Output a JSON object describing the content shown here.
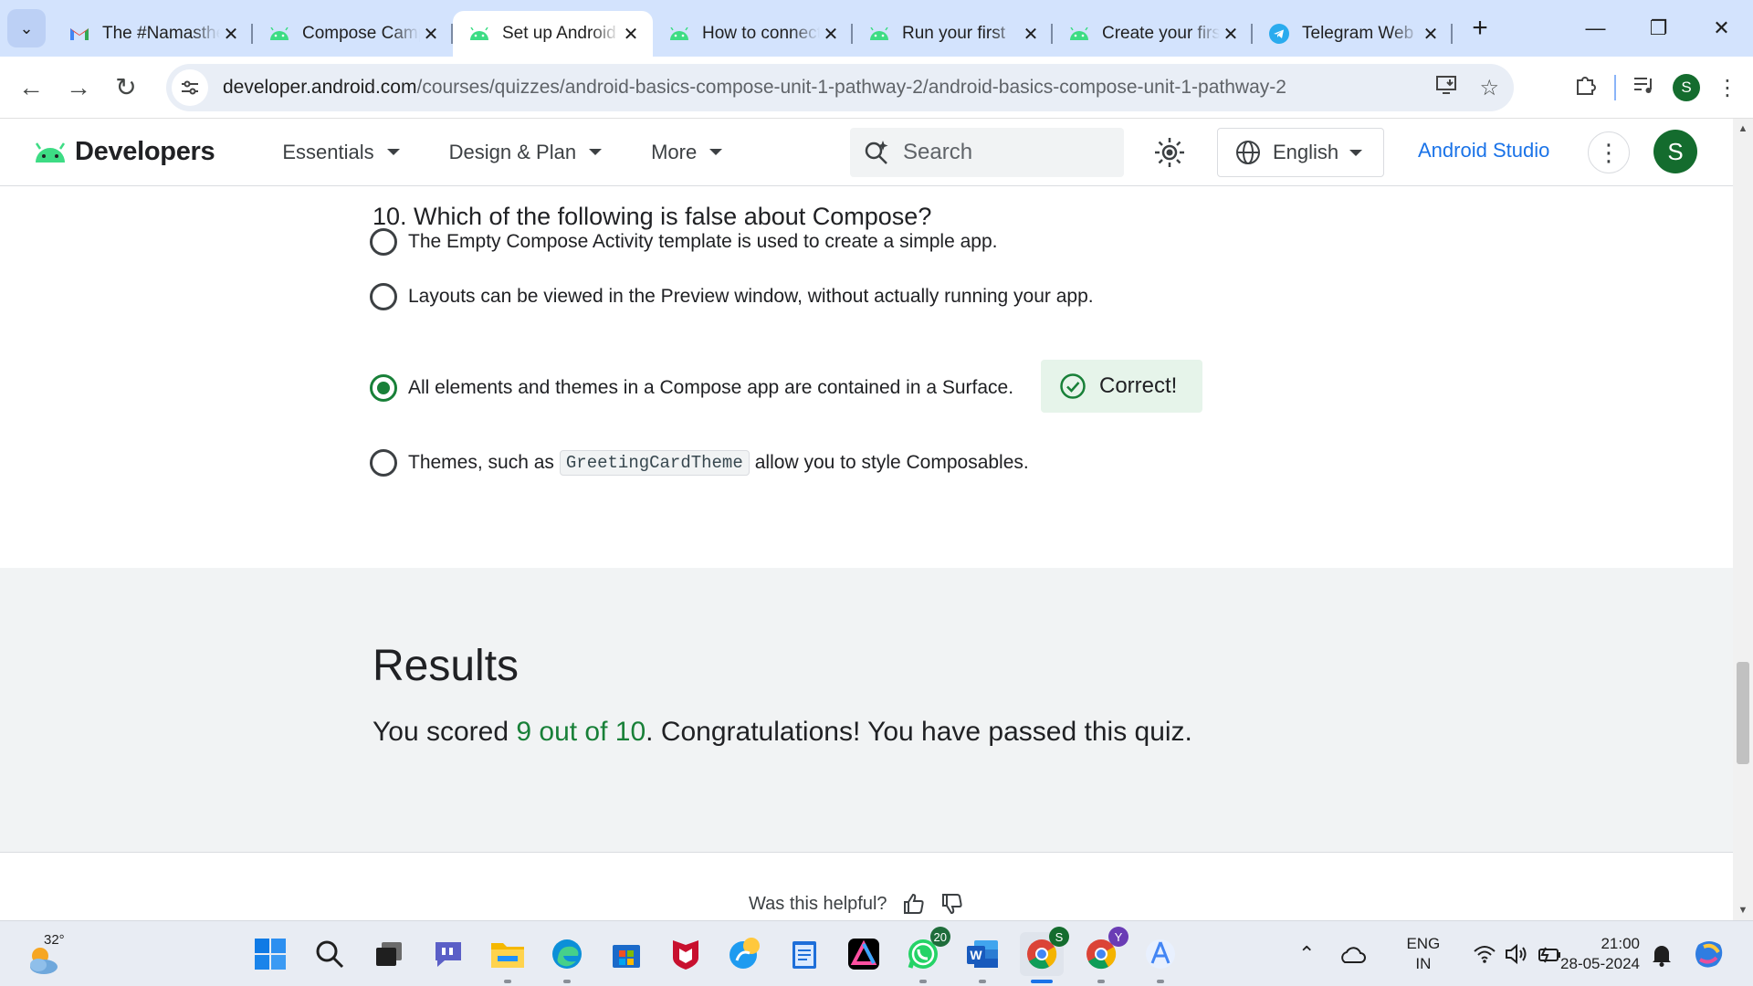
{
  "browser": {
    "tabs": [
      {
        "title": "The #Namasthe",
        "favicon": "gmail-icon"
      },
      {
        "title": "Compose Camp",
        "favicon": "android-icon"
      },
      {
        "title": "Set up Android",
        "favicon": "android-icon"
      },
      {
        "title": "How to connect",
        "favicon": "android-icon"
      },
      {
        "title": "Run your first",
        "favicon": "android-icon"
      },
      {
        "title": "Create your first",
        "favicon": "android-icon"
      },
      {
        "title": "Telegram Web",
        "favicon": "telegram-icon"
      }
    ],
    "active_tab": 2,
    "url_host": "developer.android.com",
    "url_path": "/courses/quizzes/android-basics-compose-unit-1-pathway-2/android-basics-compose-unit-1-pathway-2",
    "profile_initial": "S"
  },
  "site": {
    "logo_text": "Developers",
    "nav": [
      {
        "label": "Essentials"
      },
      {
        "label": "Design & Plan"
      },
      {
        "label": "More"
      }
    ],
    "search_placeholder": "Search",
    "language": "English",
    "studio_link": "Android Studio",
    "avatar_initial": "S"
  },
  "quiz": {
    "question": "10. Which of the following is false about Compose?",
    "options": [
      {
        "text": "The Empty Compose Activity template is used to create a simple app.",
        "selected": false
      },
      {
        "text": "Layouts can be viewed in the Preview window, without actually running your app.",
        "selected": false
      },
      {
        "text": "All elements and themes in a Compose app are contained in a Surface.",
        "selected": true
      },
      {
        "text_before": "Themes, such as",
        "code": "GreetingCardTheme",
        "text_after": "allow you to style Composables.",
        "selected": false
      }
    ],
    "feedback": "Correct!"
  },
  "results": {
    "title": "Results",
    "prefix": "You scored",
    "score": "9 out of 10",
    "suffix": ". Congratulations! You have passed this quiz."
  },
  "footer": {
    "helpful": "Was this helpful?"
  },
  "taskbar": {
    "temperature": "32°",
    "whatsapp_badge": "20",
    "chrome_badge_1": "S",
    "chrome_badge_2": "Y",
    "lang_line1": "ENG",
    "lang_line2": "IN",
    "time": "21:00",
    "date": "28-05-2024"
  },
  "colors": {
    "accent": "#1a73e8",
    "success": "#188038",
    "tabstrip": "#d3e3fd"
  }
}
